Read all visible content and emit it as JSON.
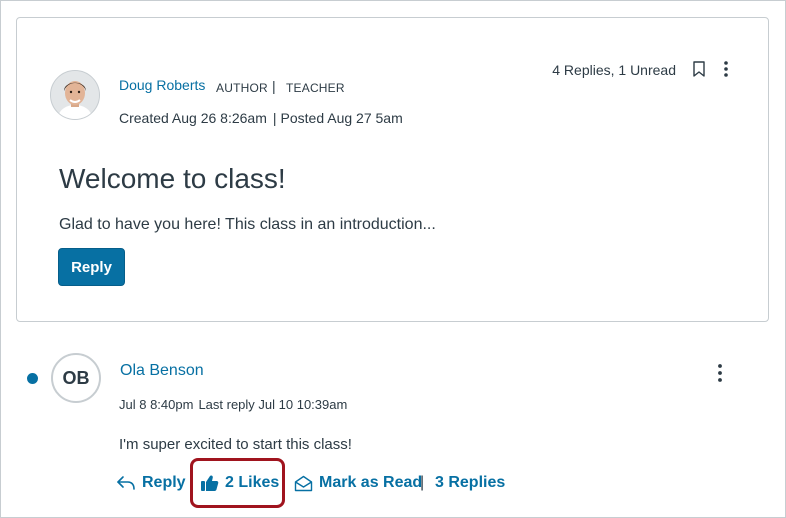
{
  "topic": {
    "author_name": "Doug Roberts",
    "role_author": "AUTHOR",
    "role_separator": "|",
    "role_teacher": "TEACHER",
    "created": "Created Aug 26 8:26am",
    "meta_separator": "|",
    "posted": "Posted Aug 27 5am",
    "replies_info": "4 Replies, 1 Unread",
    "title": "Welcome to class!",
    "body": "Glad to have you here! This class in an introduction...",
    "reply_button": "Reply"
  },
  "reply": {
    "avatar_initials": "OB",
    "author_name": "Ola Benson",
    "posted": "Jul 8 8:40pm",
    "last_reply": "Last reply Jul 10 10:39am",
    "body": "I'm super excited to start this class!",
    "actions": {
      "reply": "Reply",
      "likes": "2 Likes",
      "mark_as_read": "Mark as Read",
      "separator": "|",
      "replies": "3 Replies"
    }
  },
  "icons": {
    "bookmark": "bookmark-icon",
    "more_options": "kebab-menu-icon",
    "reply": "reply-arrow-icon",
    "like": "thumbs-up-icon",
    "mark_read": "envelope-open-icon"
  },
  "colors": {
    "link": "#0770a3",
    "text": "#2d3b45",
    "border": "#c7cdd1",
    "highlight": "#a0141e"
  }
}
